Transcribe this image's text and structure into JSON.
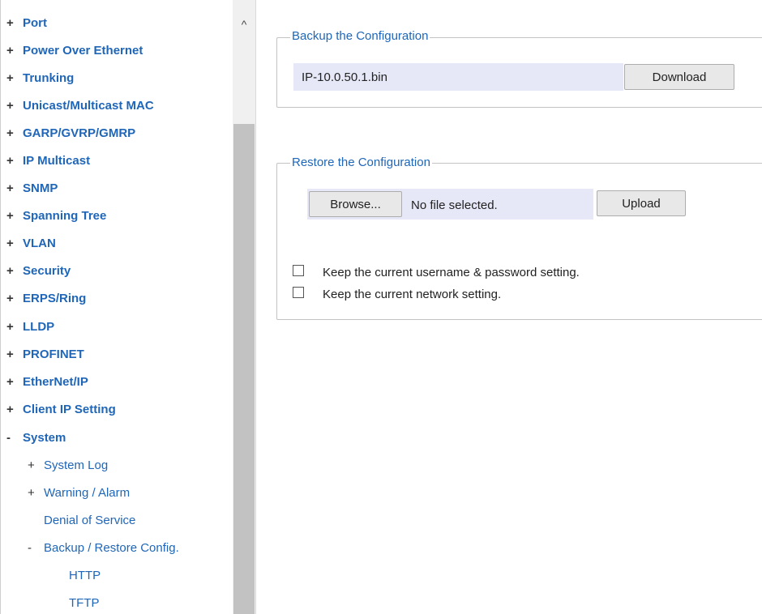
{
  "sidebar": {
    "items": [
      {
        "sign": "+",
        "label": "Port"
      },
      {
        "sign": "+",
        "label": "Power Over Ethernet"
      },
      {
        "sign": "+",
        "label": "Trunking"
      },
      {
        "sign": "+",
        "label": "Unicast/Multicast MAC"
      },
      {
        "sign": "+",
        "label": "GARP/GVRP/GMRP"
      },
      {
        "sign": "+",
        "label": "IP Multicast"
      },
      {
        "sign": "+",
        "label": "SNMP"
      },
      {
        "sign": "+",
        "label": "Spanning Tree"
      },
      {
        "sign": "+",
        "label": "VLAN"
      },
      {
        "sign": "+",
        "label": "Security"
      },
      {
        "sign": "+",
        "label": "ERPS/Ring"
      },
      {
        "sign": "+",
        "label": "LLDP"
      },
      {
        "sign": "+",
        "label": "PROFINET"
      },
      {
        "sign": "+",
        "label": "EtherNet/IP"
      },
      {
        "sign": "+",
        "label": "Client IP Setting"
      },
      {
        "sign": "-",
        "label": "System"
      }
    ],
    "system_sub": [
      {
        "sign": "+",
        "label": "System Log"
      },
      {
        "sign": "+",
        "label": "Warning / Alarm"
      },
      {
        "sign": "",
        "label": "Denial of Service"
      },
      {
        "sign": "-",
        "label": "Backup / Restore Config."
      }
    ],
    "backup_sub": [
      {
        "label": "HTTP"
      },
      {
        "label": "TFTP"
      }
    ],
    "scroll_up_glyph": "^"
  },
  "backup": {
    "legend": "Backup the Configuration",
    "filename": "IP-10.0.50.1.bin",
    "download_label": "Download"
  },
  "restore": {
    "legend": "Restore the Configuration",
    "browse_label": "Browse...",
    "file_status": "No file selected.",
    "upload_label": "Upload",
    "keep_user_label": "Keep the current username & password setting.",
    "keep_network_label": "Keep the current network setting.",
    "keep_user_checked": false,
    "keep_network_checked": false
  },
  "colors": {
    "link": "#1f66b8",
    "field_bg": "#e6e8f8",
    "scroll_thumb": "#c2c2c2"
  }
}
